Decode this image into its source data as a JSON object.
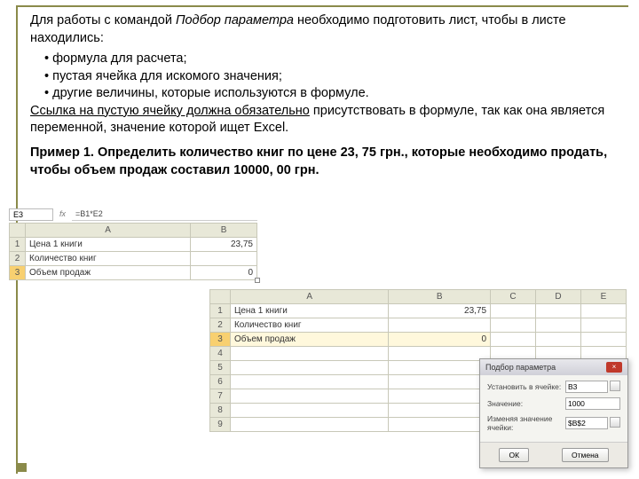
{
  "text": {
    "intro_a": "Для работы с командой ",
    "intro_emph": "Подбор параметра",
    "intro_b": " необходимо подготовить лист, чтобы в листе находились:",
    "b1": "формула для расчета;",
    "b2": "пустая ячейка для искомого значения;",
    "b3": "другие величины, которые используются в формуле.",
    "ref_a": "Ссылка на пустую ячейку должна обязательно",
    "ref_b": " присутствовать в формуле, так как она является переменной, значение которой ищет Excel.",
    "example": "Пример 1. Определить количество книг по цене 23, 75 грн., которые необходимо продать, чтобы объем продаж составил 10000, 00 грн."
  },
  "small": {
    "namebox": "E3",
    "fx": "fx",
    "formula": "=B1*E2",
    "colA": "A",
    "colB": "B",
    "r1a": "Цена 1 книги",
    "r1b": "23,75",
    "r2a": "Количество книг",
    "r2b": "",
    "r3a": "Объем продаж",
    "r3b": "0"
  },
  "big": {
    "cols": [
      "A",
      "B",
      "C",
      "D",
      "E"
    ],
    "r1a": "Цена 1 книги",
    "r1b": "23,75",
    "r2a": "Количество книг",
    "r2b": "",
    "r3a": "Объем продаж",
    "r3b": "0"
  },
  "dialog": {
    "title": "Подбор параметра",
    "l1": "Установить в ячейке:",
    "v1": "B3",
    "l2": "Значение:",
    "v2": "1000",
    "l3": "Изменяя значение ячейки:",
    "v3": "$B$2",
    "ok": "ОК",
    "cancel": "Отмена"
  }
}
